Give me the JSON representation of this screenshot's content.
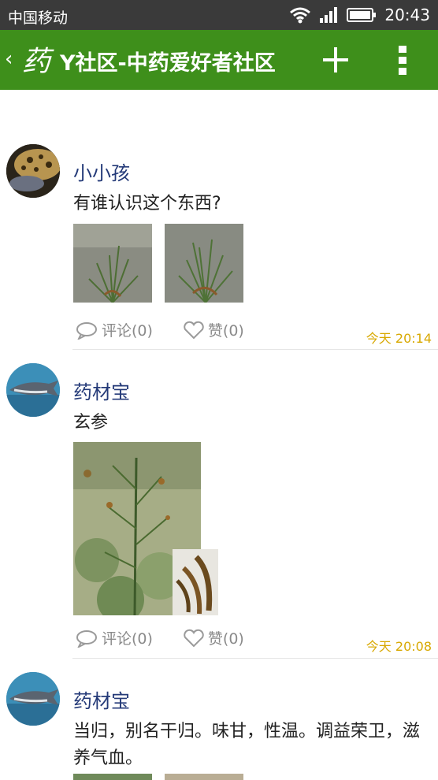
{
  "status_bar": {
    "carrier": "中国移动",
    "time": "20:43"
  },
  "app_bar": {
    "back": "‹",
    "logo_char": "药",
    "title": "Y社区-中药爱好者社区",
    "add_icon": "plus-icon",
    "menu_icon": "more-vertical-icon"
  },
  "colors": {
    "header": "#3e8f1b",
    "username": "#243a78",
    "timestamp": "#d8a800"
  },
  "posts": [
    {
      "user": "小小孩",
      "text": "有谁认识这个东西?",
      "comment": "评论(0)",
      "like": "赞(0)",
      "time": "今天 20:14"
    },
    {
      "user": "药材宝",
      "text": "玄参",
      "comment": "评论(0)",
      "like": "赞(0)",
      "time": "今天 20:08"
    },
    {
      "user": "药材宝",
      "text": "当归，别名干归。味甘，性温。调益荣卫，滋养气血。"
    }
  ]
}
